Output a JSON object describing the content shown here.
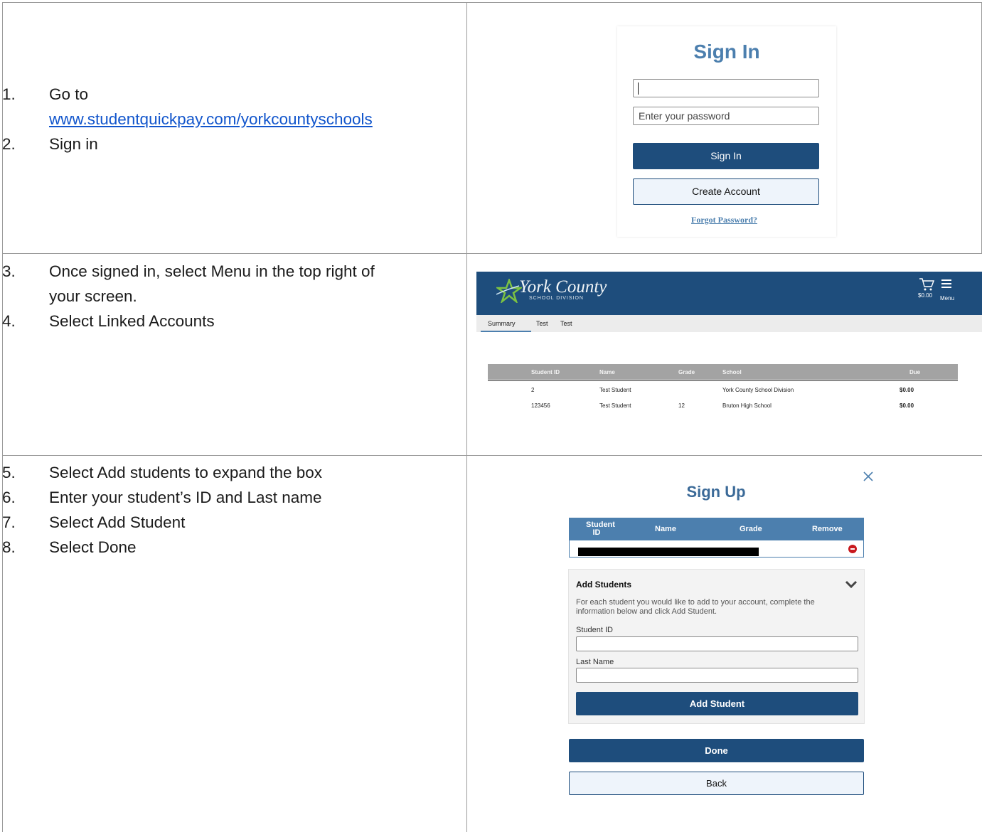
{
  "instructions": {
    "row1": {
      "step1_num": "1.",
      "step1_text": "Go to",
      "step1_link": "www.studentquickpay.com/yorkcountyschools",
      "step2_num": "2.",
      "step2_text": "Sign in"
    },
    "row2": {
      "step3_num": "3.",
      "step3_line1": "Once signed in, select Menu in the top right of",
      "step3_line2": "your screen.",
      "step4_num": "4.",
      "step4_text": "Select Linked Accounts"
    },
    "row3": {
      "step5_num": "5.",
      "step5_text": "Select Add students to expand the box",
      "step6_num": "6.",
      "step6_text": "Enter your student’s ID and Last name",
      "step7_num": "7.",
      "step7_text": "Select Add Student",
      "step8_num": "8.",
      "step8_text": "Select Done"
    }
  },
  "signin": {
    "title": "Sign In",
    "username_value": "",
    "password_placeholder": "Enter your password",
    "signin_button": "Sign In",
    "create_account_button": "Create Account",
    "forgot_link": "Forgot Password?"
  },
  "dashboard": {
    "logo_text": "York County",
    "logo_subtext": "SCHOOL DIVISION",
    "cart_amount": "$0.00",
    "menu_label": "Menu",
    "tabs": [
      "Summary",
      "Test",
      "Test"
    ],
    "columns": [
      "Student ID",
      "Name",
      "Grade",
      "School",
      "Due"
    ],
    "rows": [
      [
        "2",
        "Test Student",
        "",
        "York County School Division",
        "$0.00"
      ],
      [
        "123456",
        "Test Student",
        "12",
        "Bruton High School",
        "$0.00"
      ]
    ],
    "header_color": "#1e4d7c"
  },
  "signup": {
    "title": "Sign Up",
    "columns": [
      "Student ID",
      "Name",
      "Grade",
      "Remove"
    ],
    "add_students_title": "Add Students",
    "add_students_desc": "For each student you would like to add to your account, complete the information below and click Add Student.",
    "student_id_label": "Student ID",
    "last_name_label": "Last Name",
    "add_student_button": "Add Student",
    "done_button": "Done",
    "back_button": "Back",
    "accent_color": "#4c7fae"
  }
}
